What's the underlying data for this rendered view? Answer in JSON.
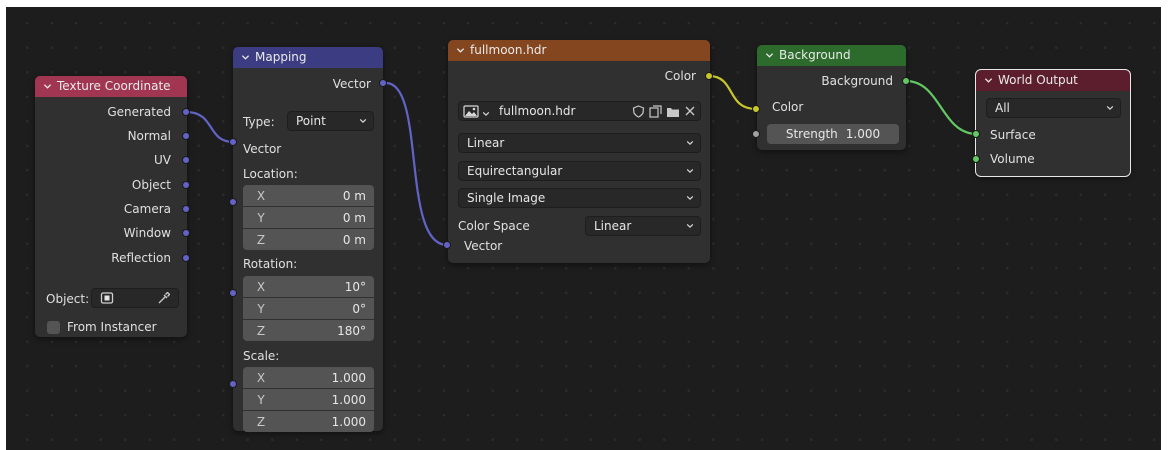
{
  "nodes": {
    "texture_coordinate": {
      "title": "Texture Coordinate",
      "header_color": "#a03651",
      "outputs": [
        "Generated",
        "Normal",
        "UV",
        "Object",
        "Camera",
        "Window",
        "Reflection"
      ],
      "object_label": "Object:",
      "from_instancer_label": "From Instancer"
    },
    "mapping": {
      "title": "Mapping",
      "header_color": "#3c3c83",
      "output_vector": "Vector",
      "type_label": "Type:",
      "type_value": "Point",
      "input_vector": "Vector",
      "location_label": "Location:",
      "location": [
        {
          "axis": "X",
          "value": "0 m"
        },
        {
          "axis": "Y",
          "value": "0 m"
        },
        {
          "axis": "Z",
          "value": "0 m"
        }
      ],
      "rotation_label": "Rotation:",
      "rotation": [
        {
          "axis": "X",
          "value": "10°"
        },
        {
          "axis": "Y",
          "value": "0°"
        },
        {
          "axis": "Z",
          "value": "180°"
        }
      ],
      "scale_label": "Scale:",
      "scale": [
        {
          "axis": "X",
          "value": "1.000"
        },
        {
          "axis": "Y",
          "value": "1.000"
        },
        {
          "axis": "Z",
          "value": "1.000"
        }
      ]
    },
    "image_texture": {
      "title": "fullmoon.hdr",
      "header_color": "#83461f",
      "output_color": "Color",
      "image_name": "fullmoon.hdr",
      "interpolation": "Linear",
      "projection": "Equirectangular",
      "source": "Single Image",
      "color_space_label": "Color Space",
      "color_space_value": "Linear",
      "input_vector": "Vector"
    },
    "background": {
      "title": "Background",
      "header_color": "#2d6b2d",
      "output_background": "Background",
      "input_color": "Color",
      "strength_label": "Strength",
      "strength_value": "1.000"
    },
    "world_output": {
      "title": "World Output",
      "header_color": "#5c1e2c",
      "target": "All",
      "input_surface": "Surface",
      "input_volume": "Volume"
    }
  },
  "colors": {
    "vector_socket": "#6363c7",
    "color_socket": "#c7c729",
    "shader_socket": "#63c763",
    "float_socket": "#a1a1a1"
  },
  "icons": [
    "chevron-down-icon",
    "image-icon",
    "shield-icon",
    "duplicate-icon",
    "folder-icon",
    "close-icon",
    "eyedropper-icon",
    "object-icon"
  ]
}
